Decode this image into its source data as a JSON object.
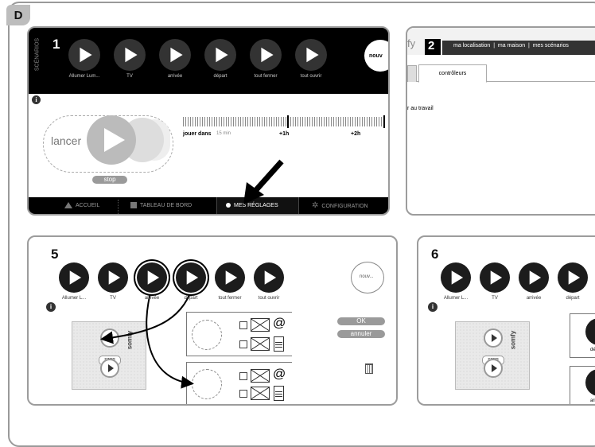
{
  "figure_letter": "D",
  "panel1": {
    "number": "1",
    "side_label": "SCÉNARIOS",
    "scenarios": [
      "Allumer Lum...",
      "TV",
      "arrivée",
      "départ",
      "tout fermer",
      "tout ouvrir"
    ],
    "new_button": "nouv",
    "launch_label": "lancer",
    "stop_label": "stop",
    "play_in_label": "jouer dans",
    "ticks": [
      "15 min",
      "+1h",
      "+2h"
    ],
    "nav": [
      "ACCUEIL",
      "TABLEAU DE BORD",
      "MES RÉGLAGES",
      "CONFIGURATION"
    ]
  },
  "panel2": {
    "number": "2",
    "logo_fragment": "fy",
    "top_links": "ma localisation  |  ma maison  |  mes scénarios",
    "tab": "contrôleurs",
    "row_text": "r au travail"
  },
  "panel5": {
    "number": "5",
    "scenarios": [
      "Allumer L...",
      "TV",
      "arrivée",
      "départ",
      "tout fermer",
      "tout ouvrir"
    ],
    "new_button": "nouv...",
    "ok_label": "OK",
    "cancel_label": "annuler",
    "remote_brand": "somfy",
    "remote_stop": "STOP",
    "at_symbol": "@"
  },
  "panel6": {
    "number": "6",
    "scenarios": [
      "Allumer L...",
      "TV",
      "arrivée",
      "départ"
    ],
    "remote_brand": "somfy",
    "remote_stop": "STOP",
    "cut_labels": [
      "dé",
      "arr"
    ]
  }
}
